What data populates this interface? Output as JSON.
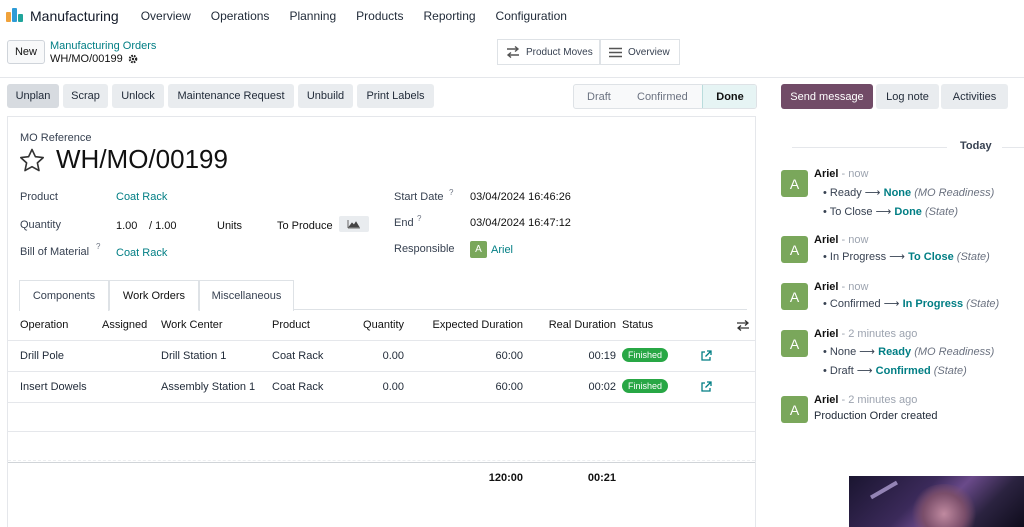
{
  "navbar": {
    "app_name": "Manufacturing",
    "menu": [
      "Overview",
      "Operations",
      "Planning",
      "Products",
      "Reporting",
      "Configuration"
    ]
  },
  "control_panel": {
    "new_label": "New",
    "breadcrumb_parent": "Manufacturing Orders",
    "breadcrumb_current": "WH/MO/00199",
    "smart_buttons": [
      "Product Moves",
      "Overview"
    ]
  },
  "actions": [
    "Unplan",
    "Scrap",
    "Unlock",
    "Maintenance Request",
    "Unbuild",
    "Print Labels"
  ],
  "stages": [
    "Draft",
    "Confirmed",
    "Done"
  ],
  "form": {
    "reference_label": "MO Reference",
    "reference": "WH/MO/00199",
    "product_label": "Product",
    "product": "Coat Rack",
    "quantity_label": "Quantity",
    "quantity_done": "1.00",
    "quantity_total": "/ 1.00",
    "uom": "Units",
    "to_produce": "To Produce",
    "bom_label": "Bill of Material",
    "help_mark": "?",
    "bom": "Coat Rack",
    "start_label": "Start Date",
    "start": "03/04/2024 16:46:26",
    "end_label": "End",
    "end": "03/04/2024 16:47:12",
    "responsible_label": "Responsible",
    "responsible": "Ariel",
    "responsible_initial": "A"
  },
  "tabs": [
    "Components",
    "Work Orders",
    "Miscellaneous"
  ],
  "table": {
    "headers": [
      "Operation",
      "Assigned",
      "Work Center",
      "Product",
      "Quantity",
      "Expected Duration",
      "Real Duration",
      "Status"
    ],
    "rows": [
      {
        "operation": "Drill Pole",
        "assigned": "",
        "work_center": "Drill Station 1",
        "product": "Coat Rack",
        "quantity": "0.00",
        "expected": "60:00",
        "real": "00:19",
        "status": "Finished"
      },
      {
        "operation": "Insert Dowels",
        "assigned": "",
        "work_center": "Assembly Station 1",
        "product": "Coat Rack",
        "quantity": "0.00",
        "expected": "60:00",
        "real": "00:02",
        "status": "Finished"
      }
    ],
    "total_expected": "120:00",
    "total_real": "00:21"
  },
  "chatter": {
    "buttons": [
      "Send message",
      "Log note",
      "Activities"
    ],
    "date_separator": "Today",
    "messages": [
      {
        "initial": "A",
        "author": "Ariel",
        "time": "- now",
        "lines": [
          {
            "old": "Ready",
            "new": "None",
            "field": "(MO Readiness)"
          },
          {
            "old": "To Close",
            "new": "Done",
            "field": "(State)"
          }
        ]
      },
      {
        "initial": "A",
        "author": "Ariel",
        "time": "- now",
        "lines": [
          {
            "old": "In Progress",
            "new": "To Close",
            "field": "(State)"
          }
        ]
      },
      {
        "initial": "A",
        "author": "Ariel",
        "time": "- now",
        "lines": [
          {
            "old": "Confirmed",
            "new": "In Progress",
            "field": "(State)"
          }
        ]
      },
      {
        "initial": "A",
        "author": "Ariel",
        "time": "- 2 minutes ago",
        "lines": [
          {
            "old": "None",
            "new": "Ready",
            "field": "(MO Readiness)"
          },
          {
            "old": "Draft",
            "new": "Confirmed",
            "field": "(State)"
          }
        ]
      },
      {
        "initial": "A",
        "author": "Ariel",
        "time": "- 2 minutes ago",
        "body": "Production Order created"
      }
    ]
  },
  "colors": {
    "accent": "#017e84",
    "send_message": "#714b67",
    "finished_badge": "#28a745",
    "avatar": "#7aa75b"
  }
}
